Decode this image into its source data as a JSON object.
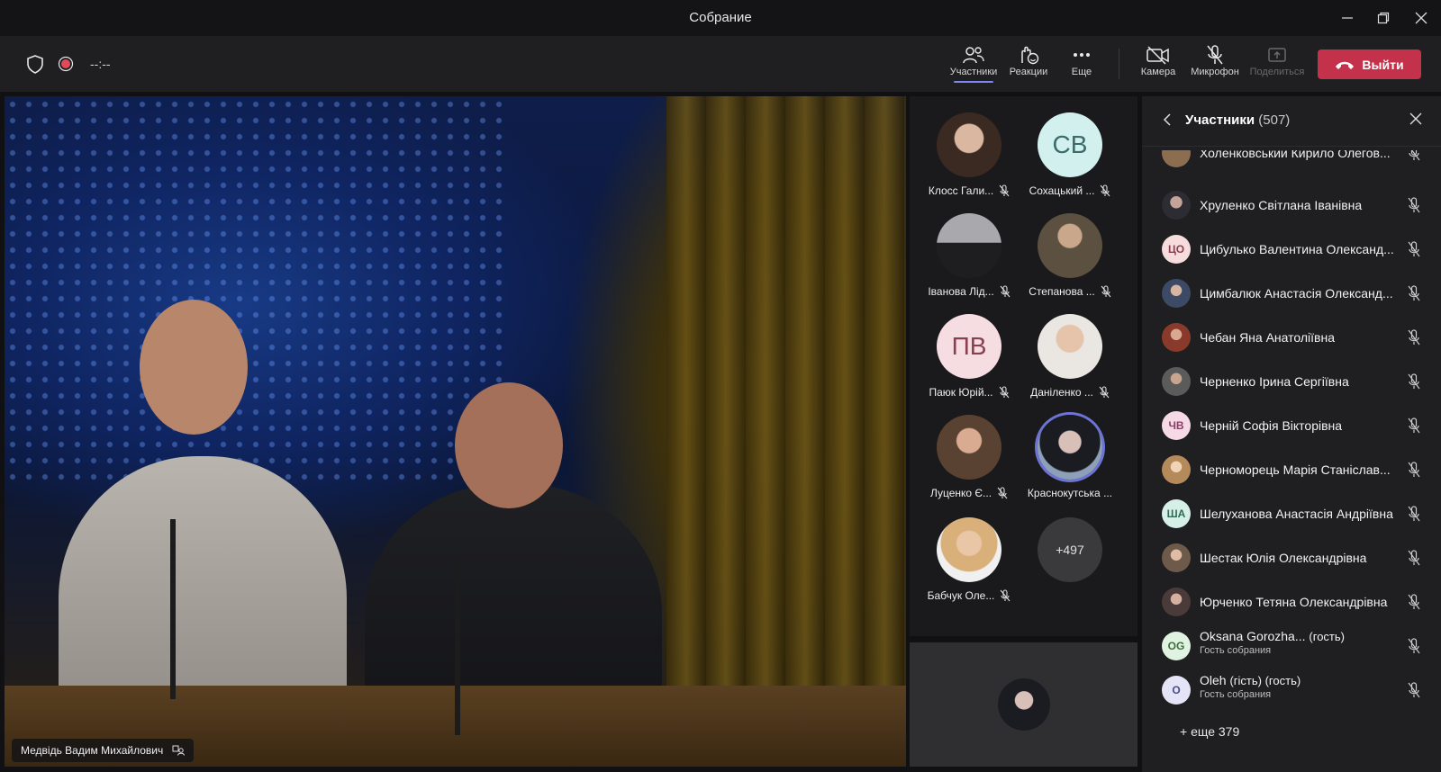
{
  "window": {
    "title": "Собрание"
  },
  "toolbar": {
    "timer": "--:--",
    "participants_label": "Участники",
    "reactions_label": "Реакции",
    "more_label": "Еще",
    "camera_label": "Камера",
    "mic_label": "Микрофон",
    "share_label": "Поделиться",
    "leave_label": "Выйти"
  },
  "stage": {
    "speaker_name": "Медвідь Вадим Михайлович"
  },
  "gallery": {
    "tiles": [
      {
        "name": "Клосс Гали...",
        "initials": "",
        "color": "#8a6a58"
      },
      {
        "name": "Сохацький ...",
        "initials": "СВ",
        "color": "#d2f0ee"
      },
      {
        "name": "Іванова Лід...",
        "initials": "",
        "color": "#6d6f74"
      },
      {
        "name": "Степанова ...",
        "initials": "",
        "color": "#6a5f4f"
      },
      {
        "name": "Паюк Юрій...",
        "initials": "ПВ",
        "color": "#f6dde2"
      },
      {
        "name": "Даніленко ...",
        "initials": "",
        "color": "#b9a08c"
      },
      {
        "name": "Луценко Є...",
        "initials": "",
        "color": "#7e6450"
      },
      {
        "name": "Краснокутська ...",
        "initials": "",
        "color": "#4d5a6e"
      },
      {
        "name": "Бабчук Оле...",
        "initials": "",
        "color": "#c9a881"
      }
    ],
    "more_count": "+497"
  },
  "panel": {
    "title": "Участники",
    "count": "(507)",
    "participants": [
      {
        "name": "Холенковський Кирило Олегов...",
        "initials": "",
        "color": "#8c6d4f"
      },
      {
        "name": "Хруленко Світлана Іванівна",
        "initials": "",
        "color": "#3a3a40"
      },
      {
        "name": "Цибулько Валентина Олександ...",
        "initials": "ЦО",
        "color": "#f6dcdc"
      },
      {
        "name": "Цимбалюк Анастасія Олександ...",
        "initials": "",
        "color": "#3d4a66"
      },
      {
        "name": "Чебан Яна Анатоліївна",
        "initials": "",
        "color": "#8a3a2a"
      },
      {
        "name": "Черненко Ірина Сергіївна",
        "initials": "",
        "color": "#5b5b5b"
      },
      {
        "name": "Черній Софія Вікторівна",
        "initials": "ЧВ",
        "color": "#f5d9e4"
      },
      {
        "name": "Черноморець Марія Станіслав...",
        "initials": "",
        "color": "#b58a5a"
      },
      {
        "name": "Шелуханова Анастасія Андріївна",
        "initials": "ША",
        "color": "#d6f0e8"
      },
      {
        "name": "Шестак Юлія Олександрівна",
        "initials": "",
        "color": "#6e5a4a"
      },
      {
        "name": "Юрченко Тетяна Олександрівна",
        "initials": "",
        "color": "#4a3a3a"
      }
    ],
    "guests": [
      {
        "name": "Oksana Gorozha...",
        "tag": "(гость)",
        "sub": "Гость собрания",
        "initials": "OG",
        "color": "#e0f2e0"
      },
      {
        "name": "Oleh",
        "tag": "(гість) (гость)",
        "sub": "Гость собрания",
        "initials": "O",
        "color": "#e4e4f6"
      }
    ],
    "more_text": "+ еще 379"
  },
  "colors": {
    "accent": "#7f85f5",
    "leave": "#c4314b",
    "panel_bg": "#1f1f21"
  }
}
